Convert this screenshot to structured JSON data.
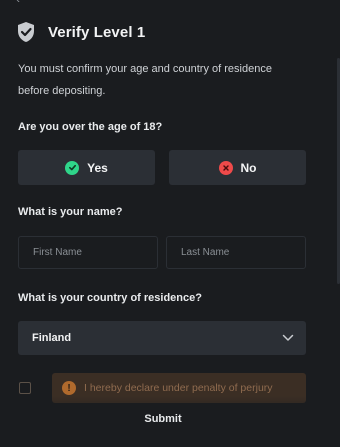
{
  "header": {
    "title": "Verify Level 1",
    "back_icon": "chevron-left-icon",
    "shield_icon": "shield-check-icon"
  },
  "intro": {
    "line1": "You must confirm your age and country of residence",
    "line2": "before depositing."
  },
  "age": {
    "question": "Are you over the age of 18?",
    "yes_label": "Yes",
    "no_label": "No"
  },
  "name": {
    "question": "What is your name?",
    "first_placeholder": "First Name",
    "last_placeholder": "Last Name",
    "first_value": "",
    "last_value": ""
  },
  "country": {
    "question": "What is your country of residence?",
    "selected": "Finland"
  },
  "declaration": {
    "text": "I hereby declare under penalty of perjury",
    "checked": false
  },
  "submit_label": "Submit",
  "colors": {
    "background": "#1a1c1f",
    "button": "#2b2f35",
    "yes_accent": "#2fd58a",
    "no_accent": "#ef4a4a",
    "warning_bg": "#3b2e24",
    "warning_icon": "#b06a2d"
  }
}
